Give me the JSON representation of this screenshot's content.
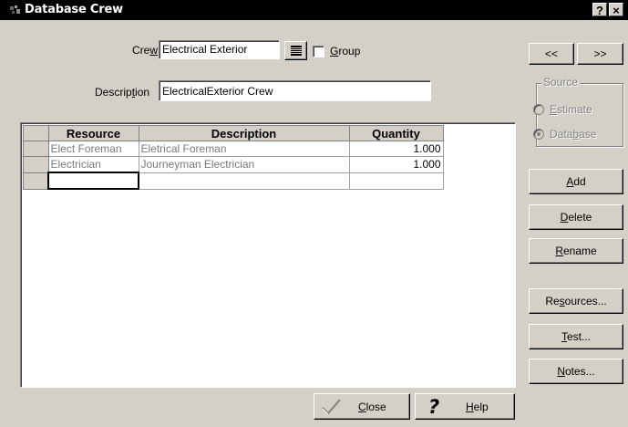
{
  "window": {
    "title": "Database Crew",
    "help_glyph": "?",
    "close_glyph": "×"
  },
  "form": {
    "crew_label": "Crew",
    "crew_value": "Electrical Exterior",
    "group_label": "Group",
    "description_label": "Description",
    "description_value": "ElectricalExterior Crew"
  },
  "nav": {
    "prev_label": "<<",
    "next_label": ">>"
  },
  "source": {
    "legend": "Source",
    "options": [
      {
        "label": "Estimate",
        "selected": false
      },
      {
        "label": "Database",
        "selected": true
      }
    ]
  },
  "table": {
    "columns": [
      "Resource",
      "Description",
      "Quantity"
    ],
    "rows": [
      {
        "resource": "Elect Foreman",
        "description": "Eletrical Foreman",
        "quantity": "1.000"
      },
      {
        "resource": "Electrician",
        "description": "Journeyman Electrician",
        "quantity": "1.000"
      },
      {
        "resource": "",
        "description": "",
        "quantity": ""
      }
    ]
  },
  "side_buttons": {
    "add": "Add",
    "delete": "Delete",
    "rename": "Rename",
    "resources": "Resources...",
    "test": "Test...",
    "notes": "Notes..."
  },
  "bottom_buttons": {
    "close": "Close",
    "help": "Help"
  },
  "colors": {
    "dialog_bg": "#d4d0c8",
    "title_bg": "#000000",
    "disabled_text": "#808080"
  }
}
